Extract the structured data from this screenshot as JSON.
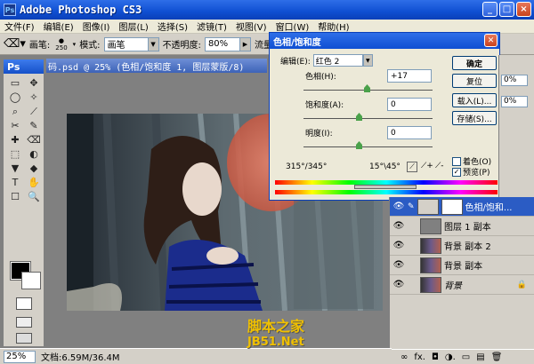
{
  "window": {
    "title": "Adobe Photoshop CS3",
    "min": "_",
    "max": "□",
    "close": "×"
  },
  "menu": [
    "文件(F)",
    "编辑(E)",
    "图像(I)",
    "图层(L)",
    "选择(S)",
    "滤镜(T)",
    "视图(V)",
    "窗口(W)",
    "帮助(H)"
  ],
  "options": {
    "brush_label": "画笔:",
    "brush_size": "250",
    "mode_label": "模式:",
    "mode_value": "画笔",
    "opacity_label": "不透明度:",
    "opacity_value": "80%",
    "flow_label": "流量:"
  },
  "toolbox": {
    "logo": "Ps",
    "tools": [
      "▭",
      "✥",
      "◯",
      "✧",
      "⌕",
      "⟋",
      "✂",
      "✎",
      "✚",
      "⌫",
      "⬚",
      "◐",
      "▼",
      "◆",
      "T",
      "✋",
      "☐",
      "🔍"
    ]
  },
  "document": {
    "tab_title": "码.psd @ 25% (色相/饱和度 1, 图层蒙版/8)"
  },
  "status": {
    "zoom": "25%",
    "doc_info": "文档:6.59M/36.4M"
  },
  "dialog": {
    "title": "色相/饱和度",
    "edit_label": "编辑(E):",
    "edit_value": "红色 2",
    "hue_label": "色相(H):",
    "hue_value": "+17",
    "sat_label": "饱和度(A):",
    "sat_value": "0",
    "light_label": "明度(I):",
    "light_value": "0",
    "range_left": "315°/345°",
    "range_right": "15°\\45°",
    "ok": "确定",
    "reset": "复位",
    "load": "载入(L)...",
    "save": "存储(S)...",
    "colorize": "着色(O)",
    "preview": "预览(P)"
  },
  "rightpanel": {
    "val1": "0%",
    "val2": "0%"
  },
  "layers": [
    {
      "name": "色相/饱和...",
      "type": "adjust",
      "selected": true
    },
    {
      "name": "图层 1 副本",
      "type": "gray"
    },
    {
      "name": "背景 副本 2",
      "type": "photo"
    },
    {
      "name": "背景 副本",
      "type": "photo"
    },
    {
      "name": "背景",
      "type": "photo",
      "locked": true
    }
  ],
  "layers_footer": [
    "∞",
    "fx.",
    "◘",
    "◑.",
    "▭",
    "▤",
    "🗑"
  ],
  "watermark": {
    "line1": "脚本之家",
    "line2": "JB51.Net"
  }
}
